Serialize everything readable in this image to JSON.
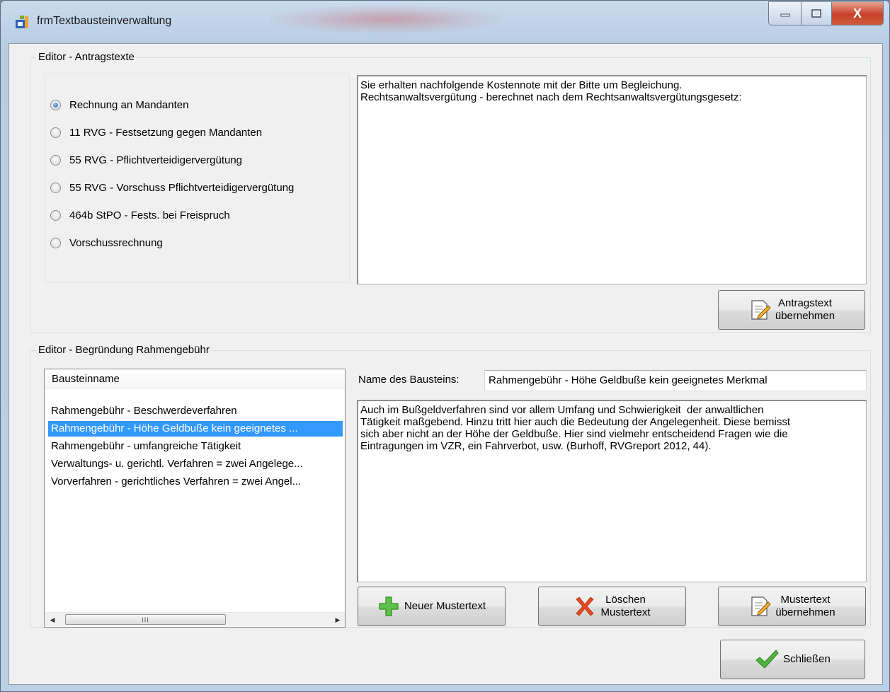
{
  "window": {
    "title": "frmTextbausteinverwaltung",
    "controls": {
      "minimize": "minimize-icon",
      "maximize": "maximize-icon",
      "close": "X"
    }
  },
  "antrag": {
    "group_title": "Editor - Antragstexte",
    "options": [
      {
        "label": "Rechnung an Mandanten",
        "checked": true
      },
      {
        "label": "11 RVG -  Festsetzung gegen Mandanten",
        "checked": false
      },
      {
        "label": "55 RVG - Pflichtverteidigervergütung",
        "checked": false
      },
      {
        "label": "55 RVG - Vorschuss Pflichtverteidigervergütung",
        "checked": false
      },
      {
        "label": "464b StPO - Fests. bei Freispruch",
        "checked": false
      },
      {
        "label": "Vorschussrechnung",
        "checked": false
      }
    ],
    "text": "Sie erhalten nachfolgende Kostennote mit der Bitte um Begleichung.\nRechtsanwaltsvergütung - berechnet nach dem Rechtsanwaltsvergütungsgesetz:",
    "apply_button": {
      "line1": "Antragstext",
      "line2": "übernehmen",
      "icon": "edit-document-icon"
    }
  },
  "rahmen": {
    "group_title": "Editor - Begründung Rahmengebühr",
    "list": {
      "header": "Bausteinname",
      "items": [
        "Rahmengebühr - Beschwerdeverfahren",
        "Rahmengebühr - Höhe Geldbuße kein geeignetes ...",
        "Rahmengebühr - umfangreiche Tätigkeit",
        "Verwaltungs- u. gerichtl. Verfahren = zwei Angelege...",
        "Vorverfahren - gerichtliches Verfahren = zwei Angel..."
      ],
      "selected_index": 1,
      "scroll_thumb": "III"
    },
    "name_label": "Name des Bausteins:",
    "name_value": "Rahmengebühr - Höhe Geldbuße kein geeignetes Merkmal",
    "text": "Auch im Bußgeldverfahren sind vor allem Umfang und Schwierigkeit  der anwaltlichen\nTätigkeit maßgebend. Hinzu tritt hier auch die Bedeutung der Angelegenheit. Diese bemisst\nsich aber nicht an der Höhe der Geldbuße. Hier sind vielmehr entscheidend Fragen wie die\nEintragungen im VZR, ein Fahrverbot, usw. (Burhoff, RVGreport 2012, 44).",
    "buttons": {
      "new": {
        "label": "Neuer Mustertext",
        "icon": "plus-icon"
      },
      "delete": {
        "line1": "Löschen",
        "line2": "Mustertext",
        "icon": "x-icon"
      },
      "apply": {
        "line1": "Mustertext",
        "line2": "übernehmen",
        "icon": "edit-document-icon"
      }
    }
  },
  "close_button": {
    "label": "Schließen",
    "icon": "checkmark-icon"
  },
  "colors": {
    "selection": "#3399ff",
    "close": "#c8412a"
  }
}
